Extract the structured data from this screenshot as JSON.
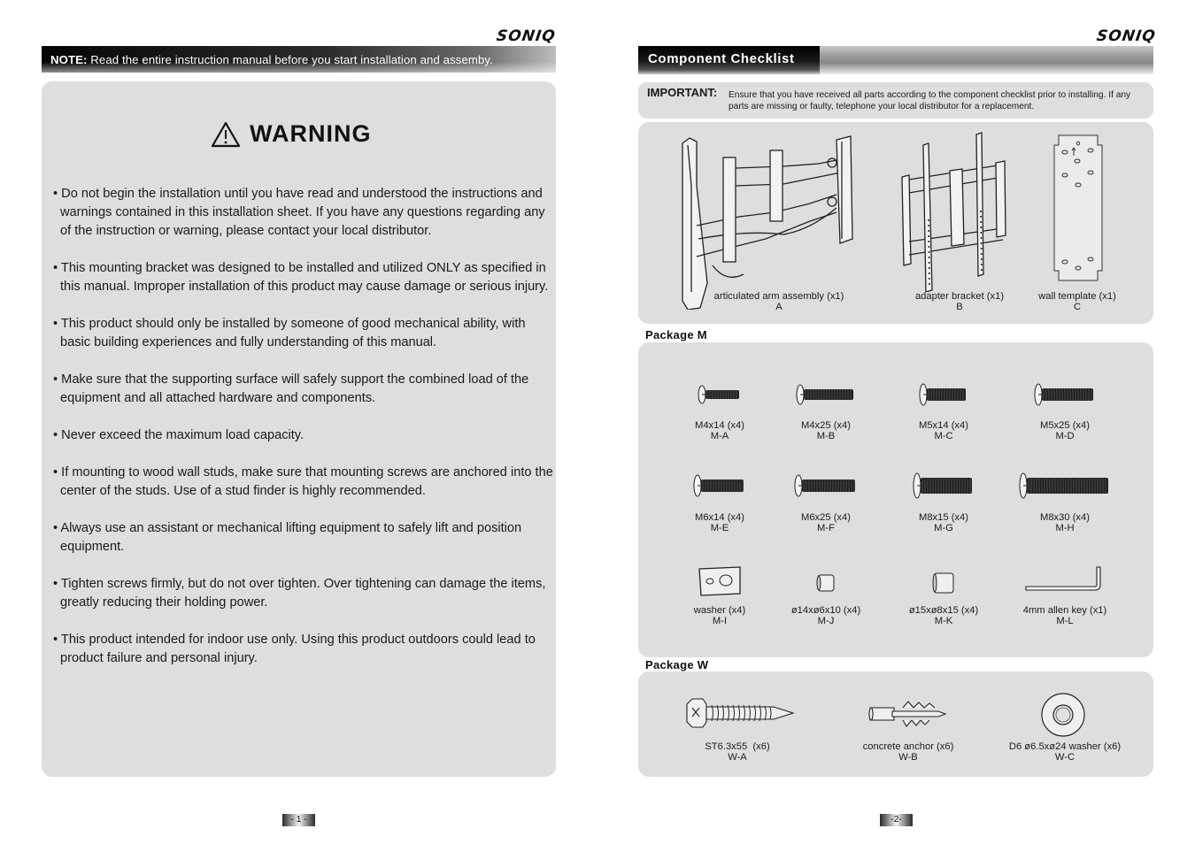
{
  "brand": "SONIQ",
  "left_page": {
    "note": {
      "label": "NOTE:",
      "text": "Read the entire instruction manual before you start installation and assemby."
    },
    "warning": {
      "icon": "warning-triangle-icon",
      "title": "WARNING",
      "bullets": [
        "• Do not begin the installation until you have read and understood the instructions and warnings contained in this installation sheet. If you have any questions regarding any of the instruction or warning, please contact your local distributor.",
        "• This mounting bracket was designed to be installed and utilized ONLY as specified in this manual. Improper installation of this product may cause damage or serious injury.",
        "• This product should only be installed by someone of good mechanical ability, with basic building experiences and fully understanding of this manual.",
        "• Make sure that the supporting surface will safely support the combined load of the equipment and all attached hardware and components.",
        "• Never exceed the maximum load capacity.",
        "• If mounting to wood wall studs, make sure that mounting screws are anchored into the center of the studs. Use of a stud finder is highly recommended.",
        "• Always use an assistant or mechanical lifting equipment to safely lift and position equipment.",
        "• Tighten screws firmly, but do not over tighten. Over tightening can damage the items, greatly reducing their holding power.",
        "• This product intended for indoor use only. Using this product outdoors could lead to product failure and personal injury."
      ]
    },
    "page_number": "- 1 -"
  },
  "right_page": {
    "title": "Component Checklist",
    "important": {
      "label": "IMPORTANT:",
      "text": "Ensure that you have received all parts according to the component checklist prior to installing. If any parts are missing or faulty, telephone your local distributor for a replacement."
    },
    "main_parts": [
      {
        "name": "articulated arm assembly (x1)",
        "code": "A",
        "icon": "articulated-arm-icon"
      },
      {
        "name": "adapter bracket (x1)",
        "code": "B",
        "icon": "adapter-bracket-icon"
      },
      {
        "name": "wall template (x1)",
        "code": "C",
        "icon": "wall-template-icon"
      }
    ],
    "package_m": {
      "label": "Package M",
      "items": [
        {
          "name": "M4x14 (x4)",
          "code": "M-A",
          "icon": "screw-icon"
        },
        {
          "name": "M4x25 (x4)",
          "code": "M-B",
          "icon": "screw-icon"
        },
        {
          "name": "M5x14 (x4)",
          "code": "M-C",
          "icon": "screw-icon"
        },
        {
          "name": "M5x25 (x4)",
          "code": "M-D",
          "icon": "screw-icon"
        },
        {
          "name": "M6x14 (x4)",
          "code": "M-E",
          "icon": "screw-icon"
        },
        {
          "name": "M6x25 (x4)",
          "code": "M-F",
          "icon": "screw-icon"
        },
        {
          "name": "M8x15 (x4)",
          "code": "M-G",
          "icon": "screw-icon"
        },
        {
          "name": "M8x30 (x4)",
          "code": "M-H",
          "icon": "screw-icon"
        },
        {
          "name": "washer (x4)",
          "code": "M-I",
          "icon": "plate-washer-icon"
        },
        {
          "name": "ø14xø6x10 (x4)",
          "code": "M-J",
          "icon": "spacer-icon"
        },
        {
          "name": "ø15xø8x15 (x4)",
          "code": "M-K",
          "icon": "spacer-icon"
        },
        {
          "name": "4mm allen key (x1)",
          "code": "M-L",
          "icon": "allen-key-icon"
        }
      ]
    },
    "package_w": {
      "label": "Package W",
      "items": [
        {
          "name": "ST6.3x55  (x6)",
          "code": "W-A",
          "icon": "lag-bolt-icon"
        },
        {
          "name": "concrete anchor (x6)",
          "code": "W-B",
          "icon": "concrete-anchor-icon"
        },
        {
          "name": "D6 ø6.5xø24 washer (x6)",
          "code": "W-C",
          "icon": "round-washer-icon"
        }
      ]
    },
    "page_number": "-2-"
  }
}
